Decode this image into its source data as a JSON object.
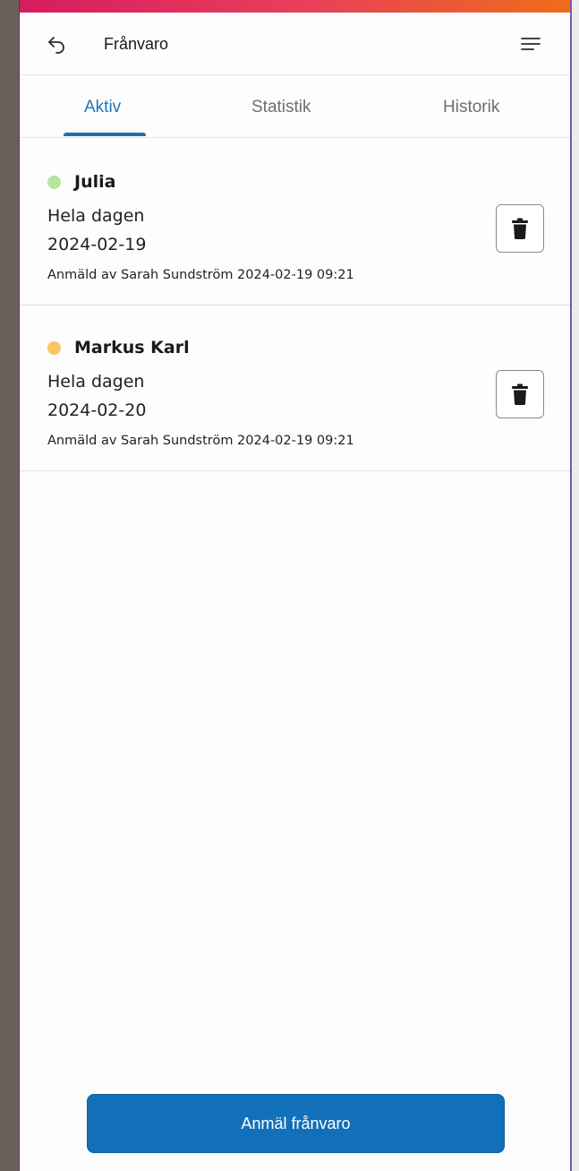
{
  "header": {
    "title": "Frånvaro",
    "back_icon": "back-arrow-icon",
    "menu_icon": "hamburger-menu-icon"
  },
  "tabs": [
    {
      "label": "Aktiv",
      "active": true
    },
    {
      "label": "Statistik",
      "active": false
    },
    {
      "label": "Historik",
      "active": false
    }
  ],
  "absences": [
    {
      "name": "Julia",
      "status_color": "#b7e4a0",
      "duration": "Hela dagen",
      "date": "2024-02-19",
      "reported": "Anmäld av Sarah Sundström 2024-02-19 09:21",
      "delete_icon": "trash-icon"
    },
    {
      "name": "Markus Karl",
      "status_color": "#fbc465",
      "duration": "Hela dagen",
      "date": "2024-02-20",
      "reported": "Anmäld av Sarah Sundström 2024-02-19 09:21",
      "delete_icon": "trash-icon"
    }
  ],
  "footer": {
    "report_button_label": "Anmäl frånvaro"
  },
  "colors": {
    "accent": "#1f74b8",
    "primary_button": "#1270b8",
    "brand_gradient_start": "#d81b60",
    "brand_gradient_end": "#ef6c1a"
  }
}
